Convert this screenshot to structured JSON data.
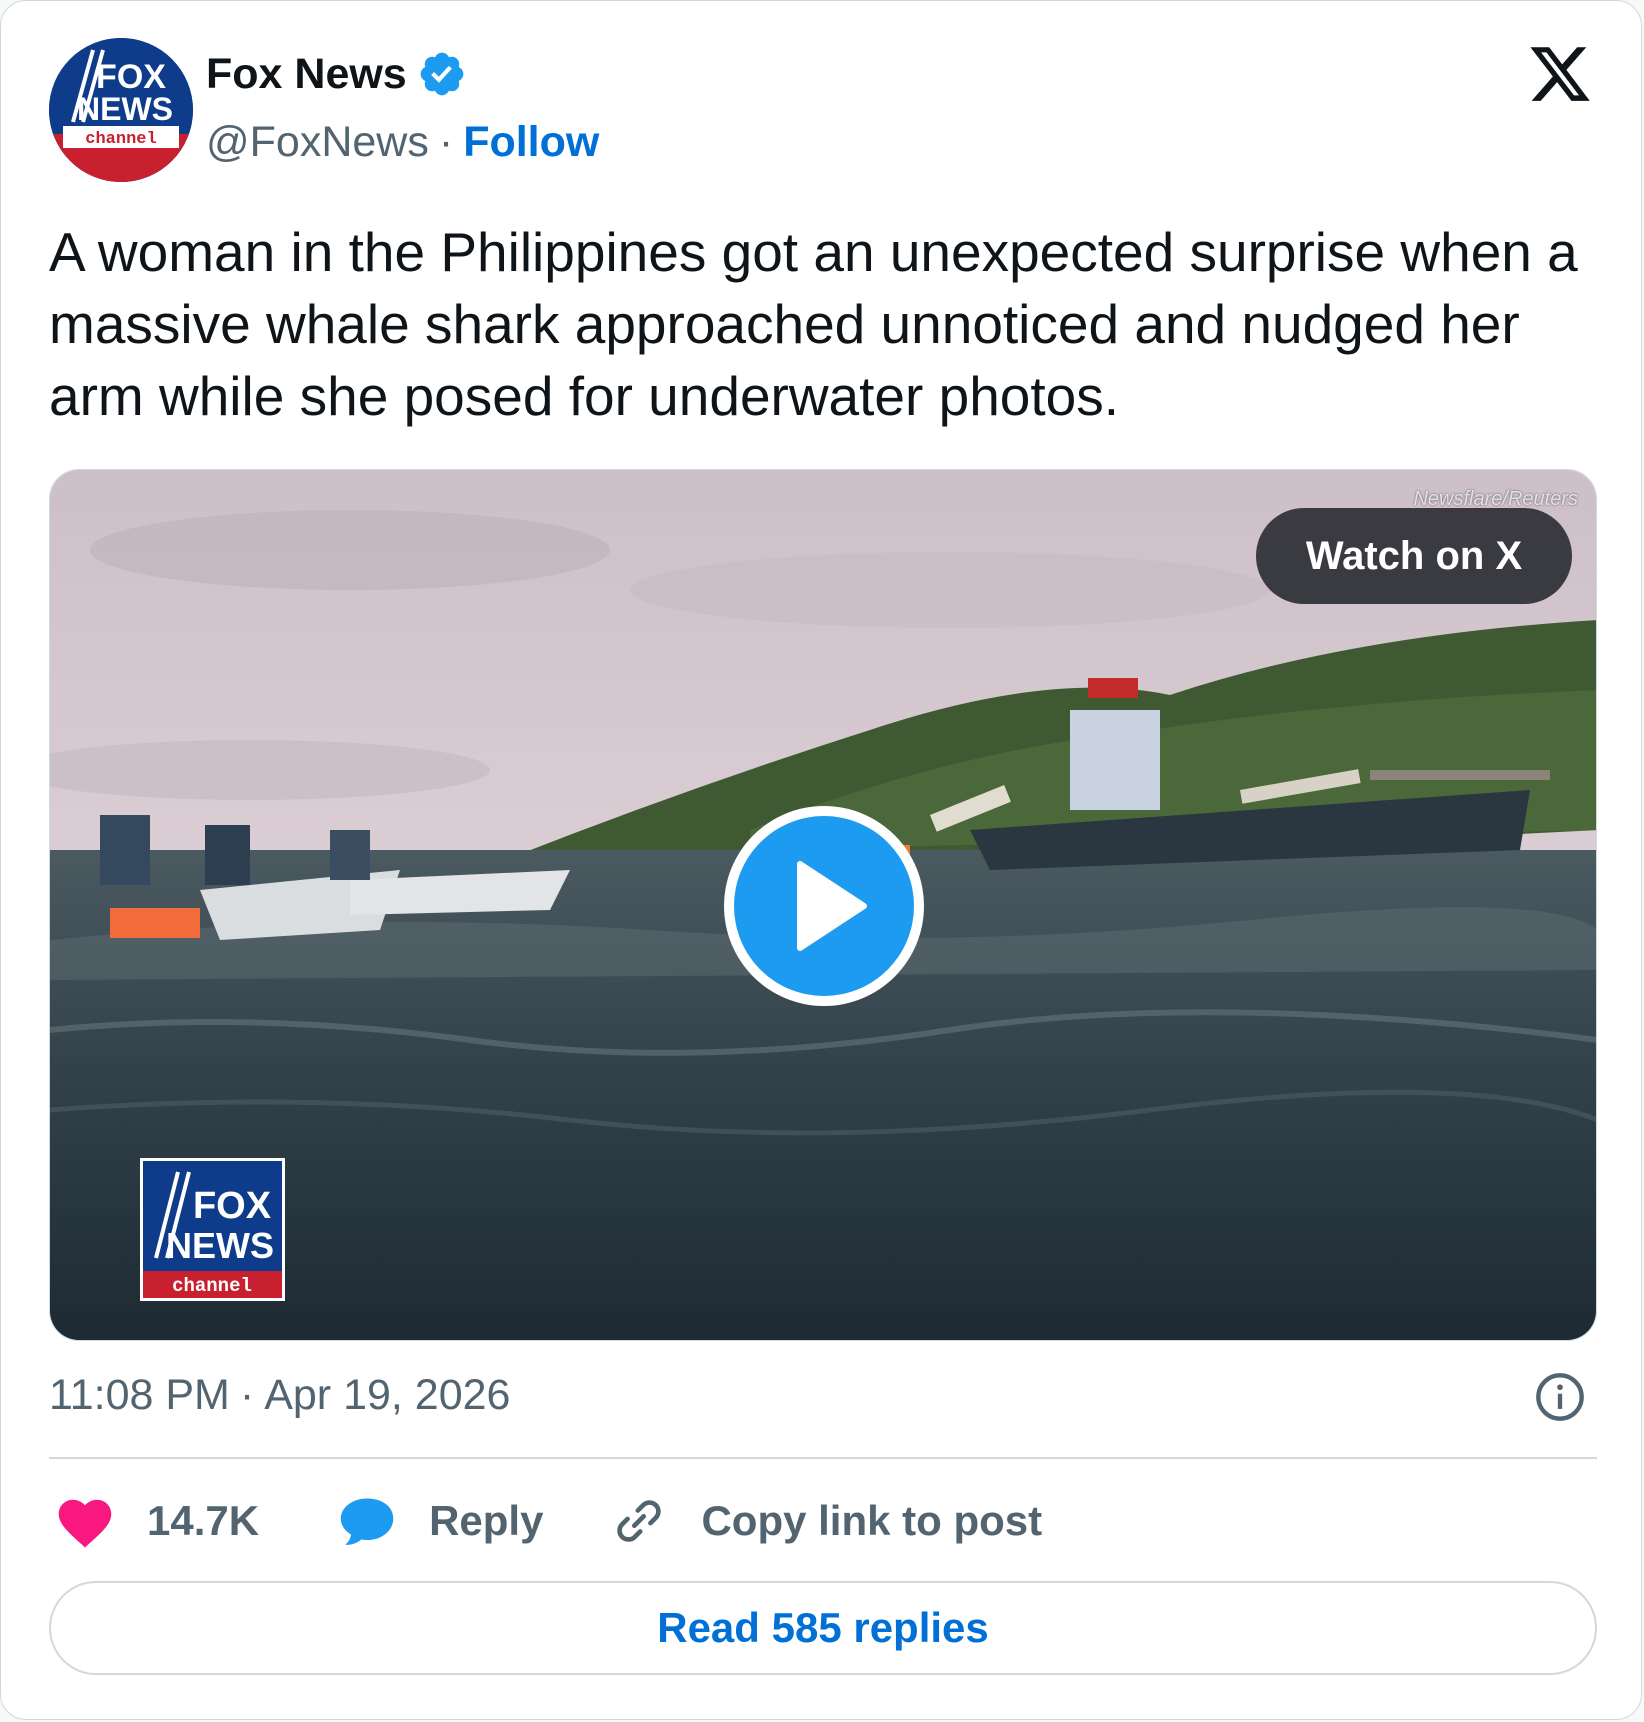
{
  "colors": {
    "accent": "#1d9bf0",
    "link": "#006fd6",
    "text": "#0f1419",
    "secondary_text": "#536471",
    "like": "#f91880",
    "border": "#cfd9de"
  },
  "account": {
    "display_name": "Fox News",
    "handle": "@FoxNews",
    "separator": "·",
    "follow_label": "Follow",
    "verified": true,
    "avatar_logo": {
      "line1": "FOX",
      "line2": "NEWS",
      "line3": "channel"
    }
  },
  "icons": {
    "platform_logo": "x-logo-icon",
    "verified": "verified-badge-icon",
    "play": "play-icon",
    "info": "info-icon",
    "like": "heart-icon",
    "reply": "speech-bubble-icon",
    "copy_link": "link-icon"
  },
  "tweet": {
    "text": "A woman in the Philippines got an unexpected surprise when a massive whale shark approached unnoticed and nudged her arm while she posed for underwater photos.",
    "media": {
      "credit": "Newsflare/Reuters",
      "watch_label": "Watch on X",
      "watermark": {
        "line1": "FOX",
        "line2": "NEWS",
        "line3": "channel"
      }
    },
    "time": "11:08 PM",
    "separator": "·",
    "date": "Apr 19, 2026"
  },
  "actions": {
    "like_count": "14.7K",
    "reply_label": "Reply",
    "copy_label": "Copy link to post"
  },
  "read_replies_label": "Read 585 replies"
}
